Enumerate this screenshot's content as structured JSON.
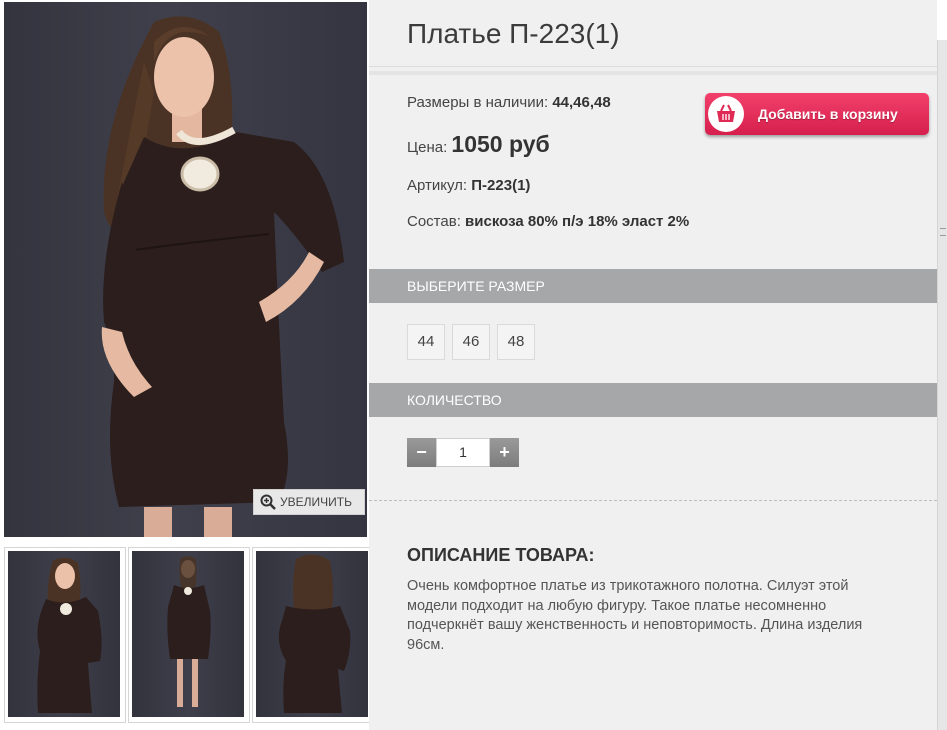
{
  "product": {
    "title": "Платье П-223(1)",
    "sizes_label": "Размеры в наличии:",
    "sizes_value": "44,46,48",
    "price_label": "Цена:",
    "price_value": "1050 руб",
    "article_label": "Артикул:",
    "article_value": "П-223(1)",
    "composition_label": "Состав:",
    "composition_value": "вискоза 80% п/э 18% эласт 2%"
  },
  "cart_button": {
    "label": "Добавить в корзину",
    "icon": "basket-icon"
  },
  "gallery": {
    "zoom_label": "УВЕЛИЧИТЬ",
    "zoom_icon": "magnifier-plus-icon",
    "thumbnails": [
      "front-view",
      "full-length-view",
      "back-view"
    ]
  },
  "size_section": {
    "title": "ВЫБЕРИТЕ РАЗМЕР",
    "options": [
      "44",
      "46",
      "48"
    ]
  },
  "quantity_section": {
    "title": "КОЛИЧЕСТВО",
    "minus": "−",
    "plus": "+",
    "value": "1"
  },
  "description": {
    "title": "ОПИСАНИЕ ТОВАРА:",
    "text": "Очень комфортное платье из трикотажного полотна. Силуэт этой модели подходит на любую фигуру. Такое платье несомненно подчеркнёт вашу женственность и неповторимость. Длина изделия 96см."
  },
  "colors": {
    "accent": "#e02a56",
    "section_bar": "#a6a7a8",
    "panel_bg": "#f0f0f0",
    "dress": "#2a1d1b",
    "backdrop": "#3a3a46"
  }
}
